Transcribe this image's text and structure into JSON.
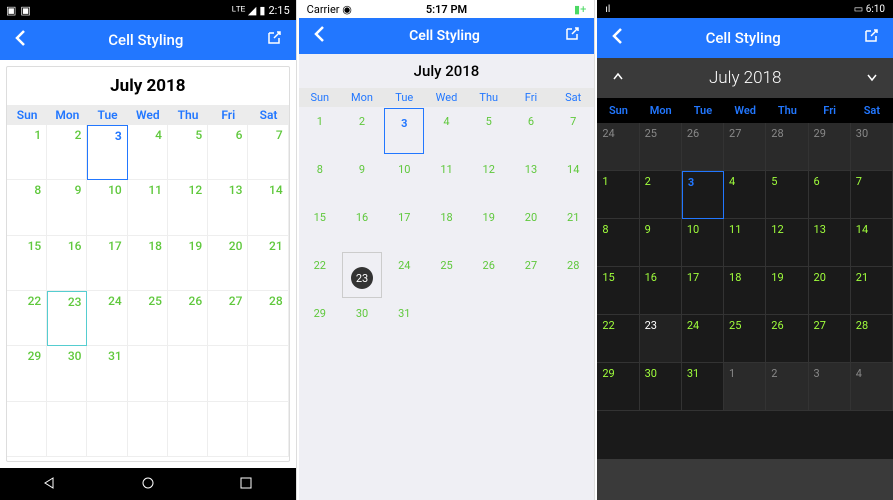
{
  "title": "Cell Styling",
  "month_label": "July 2018",
  "days": [
    "Sun",
    "Mon",
    "Tue",
    "Wed",
    "Thu",
    "Fri",
    "Sat"
  ],
  "android": {
    "status_time": "2:15",
    "cells": [
      "1",
      "2",
      "3",
      "4",
      "5",
      "6",
      "7",
      "8",
      "9",
      "10",
      "11",
      "12",
      "13",
      "14",
      "15",
      "16",
      "17",
      "18",
      "19",
      "20",
      "21",
      "22",
      "23",
      "24",
      "25",
      "26",
      "27",
      "28",
      "29",
      "30",
      "31"
    ],
    "today_index": 2,
    "sel_index": 22
  },
  "ios": {
    "carrier": "Carrier",
    "status_time": "5:17 PM",
    "cells": [
      "1",
      "2",
      "3",
      "4",
      "5",
      "6",
      "7",
      "8",
      "9",
      "10",
      "11",
      "12",
      "13",
      "14",
      "15",
      "16",
      "17",
      "18",
      "19",
      "20",
      "21",
      "22",
      "23",
      "24",
      "25",
      "26",
      "27",
      "28",
      "29",
      "30",
      "31"
    ],
    "today_index": 2,
    "sel_index": 22
  },
  "uwp": {
    "status_time": "6:10",
    "prev_days": [
      "24",
      "25",
      "26",
      "27",
      "28",
      "29",
      "30"
    ],
    "cells": [
      "1",
      "2",
      "3",
      "4",
      "5",
      "6",
      "7",
      "8",
      "9",
      "10",
      "11",
      "12",
      "13",
      "14",
      "15",
      "16",
      "17",
      "18",
      "19",
      "20",
      "21",
      "22",
      "23",
      "24",
      "25",
      "26",
      "27",
      "28",
      "29",
      "30",
      "31"
    ],
    "today_index": 2,
    "sel_index": 22,
    "next_days": [
      "1",
      "2",
      "3",
      "4"
    ]
  }
}
